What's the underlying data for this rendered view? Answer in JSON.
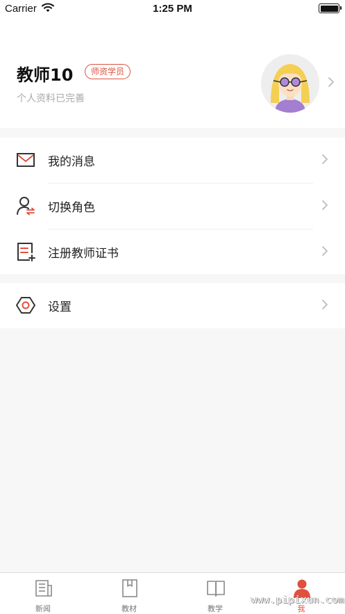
{
  "status_bar": {
    "carrier": "Carrier",
    "time": "1:25 PM",
    "battery_level": 1.0
  },
  "profile": {
    "name": "教师10",
    "badge": "师资学员",
    "subtitle": "个人资料已完善",
    "avatar_icon": "avatar-girl-glasses"
  },
  "menu": {
    "items": [
      {
        "label": "我的消息",
        "icon": "mail-icon"
      },
      {
        "label": "切换角色",
        "icon": "switch-role-icon"
      },
      {
        "label": "注册教师证书",
        "icon": "certificate-icon"
      }
    ],
    "settings": {
      "label": "设置",
      "icon": "settings-hexagon-icon"
    }
  },
  "tabbar": {
    "tabs": [
      {
        "label": "新闻",
        "icon": "news-icon",
        "active": false
      },
      {
        "label": "教材",
        "icon": "textbook-icon",
        "active": false
      },
      {
        "label": "教学",
        "icon": "teaching-book-icon",
        "active": false
      },
      {
        "label": "我",
        "icon": "me-person-icon",
        "active": true
      }
    ]
  },
  "watermark": "www.pipixun.com",
  "colors": {
    "accent": "#e0503e",
    "background": "#f7f7f7",
    "card": "#ffffff",
    "muted_text": "#aaaaaa"
  }
}
